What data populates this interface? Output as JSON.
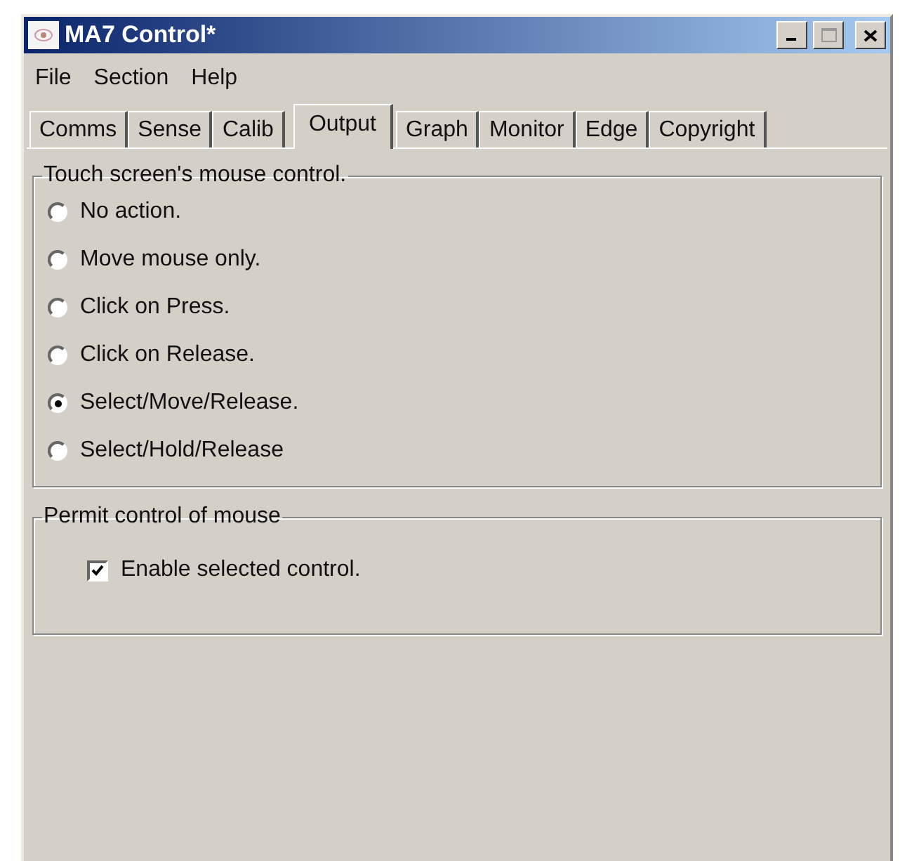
{
  "window": {
    "title": "MA7 Control*"
  },
  "menu": [
    "File",
    "Section",
    "Help"
  ],
  "tabs": [
    {
      "label": "Comms",
      "selected": false
    },
    {
      "label": "Sense",
      "selected": false
    },
    {
      "label": "Calib",
      "selected": false
    },
    {
      "label": "Output",
      "selected": true
    },
    {
      "label": "Graph",
      "selected": false
    },
    {
      "label": "Monitor",
      "selected": false
    },
    {
      "label": "Edge",
      "selected": false
    },
    {
      "label": "Copyright",
      "selected": false
    }
  ],
  "mouse_control": {
    "title": "Touch screen's mouse control.",
    "options": [
      {
        "label": "No action.",
        "selected": false
      },
      {
        "label": "Move mouse only.",
        "selected": false
      },
      {
        "label": "Click on Press.",
        "selected": false
      },
      {
        "label": "Click on Release.",
        "selected": false
      },
      {
        "label": "Select/Move/Release.",
        "selected": true
      },
      {
        "label": "Select/Hold/Release",
        "selected": false
      }
    ]
  },
  "permit": {
    "title": "Permit control of mouse",
    "checkbox": {
      "label": "Enable selected control.",
      "checked": true
    }
  }
}
